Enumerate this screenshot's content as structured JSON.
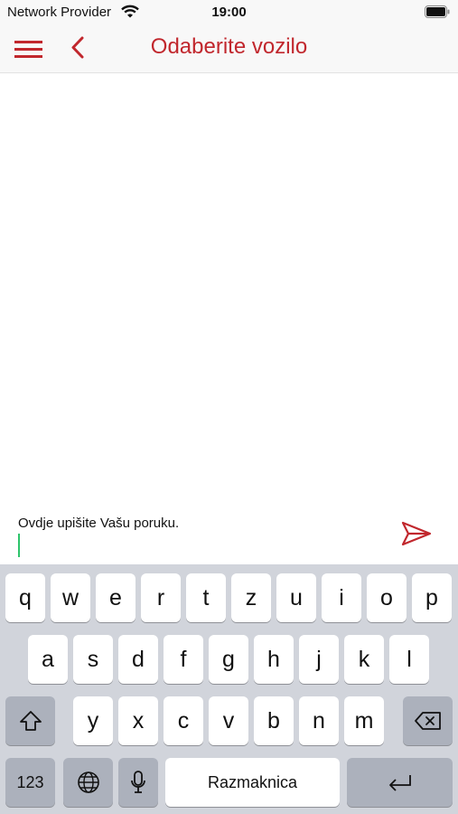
{
  "status_bar": {
    "carrier": "Network Provider",
    "time": "19:00"
  },
  "nav": {
    "title": "Odaberite vozilo"
  },
  "composer": {
    "placeholder": "Ovdje upišite Vašu poruku."
  },
  "keyboard": {
    "row1": [
      "q",
      "w",
      "e",
      "r",
      "t",
      "z",
      "u",
      "i",
      "o",
      "p"
    ],
    "row2": [
      "a",
      "s",
      "d",
      "f",
      "g",
      "h",
      "j",
      "k",
      "l"
    ],
    "row3": [
      "y",
      "x",
      "c",
      "v",
      "b",
      "n",
      "m"
    ],
    "numbers_label": "123",
    "space_label": "Razmaknica"
  },
  "icons": {
    "menu": "hamburger-icon",
    "back": "chevron-left-icon",
    "send": "send-icon",
    "shift": "shift-icon",
    "delete": "backspace-icon",
    "globe": "globe-icon",
    "mic": "microphone-icon",
    "return": "return-icon",
    "wifi": "wifi-icon",
    "battery": "battery-icon"
  },
  "colors": {
    "accent": "#c1272d",
    "cursor": "#2ec46b",
    "keyboard_bg": "#d1d4db"
  }
}
